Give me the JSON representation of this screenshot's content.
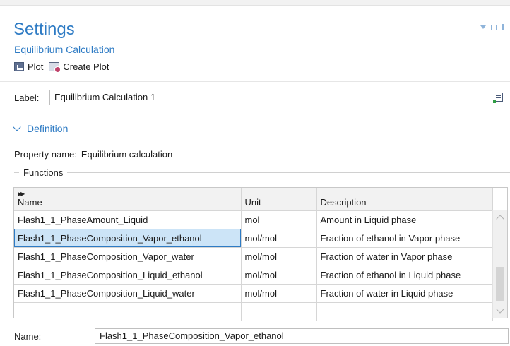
{
  "header": {
    "title": "Settings",
    "subtitle": "Equilibrium Calculation"
  },
  "toolbar": {
    "plot_label": "Plot",
    "create_plot_label": "Create Plot"
  },
  "label_field": {
    "label": "Label:",
    "value": "Equilibrium Calculation 1"
  },
  "definition": {
    "section_title": "Definition",
    "property_name_label": "Property name:",
    "property_name_value": "Equilibrium calculation",
    "functions_group": "Functions"
  },
  "functions_table": {
    "columns": [
      "Name",
      "Unit",
      "Description"
    ],
    "rows": [
      {
        "name": "Flash1_1_PhaseAmount_Liquid",
        "unit": "mol",
        "description": "Amount in Liquid phase"
      },
      {
        "name": "Flash1_1_PhaseComposition_Vapor_ethanol",
        "unit": "mol/mol",
        "description": "Fraction of ethanol in Vapor phase"
      },
      {
        "name": "Flash1_1_PhaseComposition_Vapor_water",
        "unit": "mol/mol",
        "description": "Fraction of water in Vapor phase"
      },
      {
        "name": "Flash1_1_PhaseComposition_Liquid_ethanol",
        "unit": "mol/mol",
        "description": "Fraction of ethanol in Liquid phase"
      },
      {
        "name": "Flash1_1_PhaseComposition_Liquid_water",
        "unit": "mol/mol",
        "description": "Fraction of water in Liquid phase"
      }
    ],
    "selected_row": 1
  },
  "name_field": {
    "label": "Name:",
    "value": "Flash1_1_PhaseComposition_Vapor_ethanol"
  },
  "colors": {
    "accent": "#2e7bc4",
    "selection": "#cce4f7"
  }
}
